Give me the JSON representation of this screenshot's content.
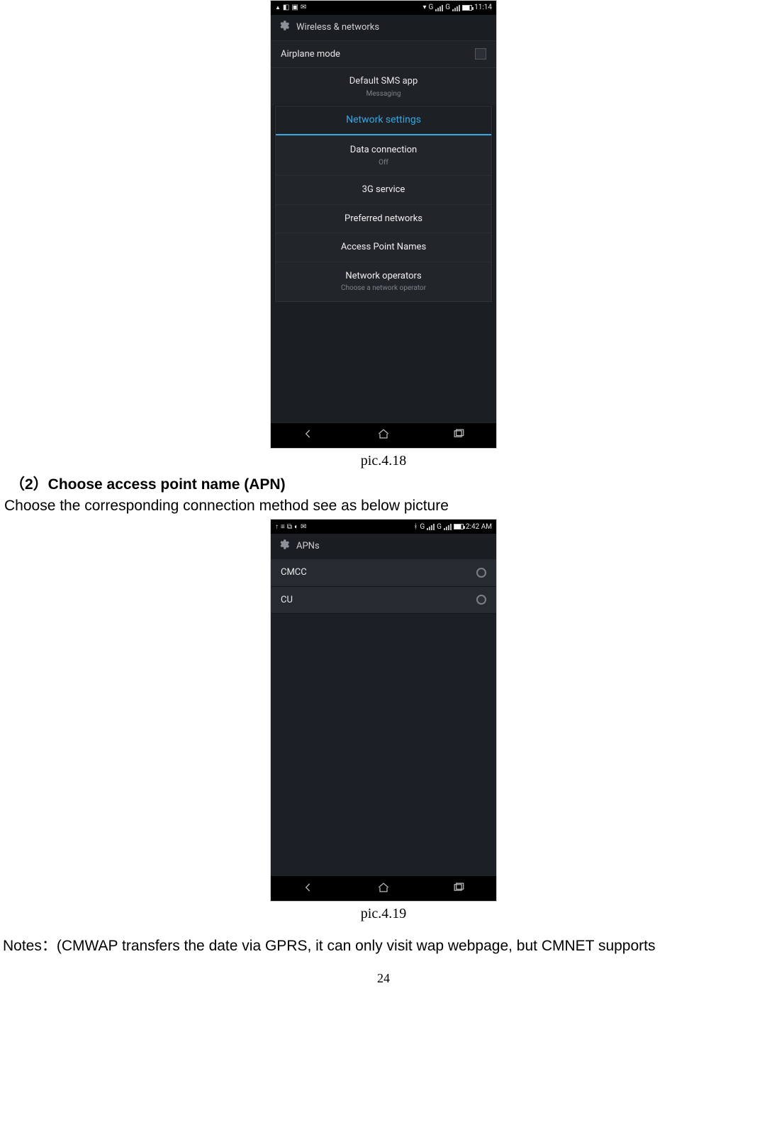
{
  "captions": {
    "pic418": "pic.4.18",
    "pic419": "pic.4.19"
  },
  "heading2": "（2）Choose access point name (APN)",
  "body_line": "Choose the corresponding connection method see as below picture",
  "notes_line": "Notes：(CMWAP transfers the date via GPRS, it can only visit wap webpage, but CMNET supports",
  "page_number": "24",
  "phone1": {
    "status": {
      "time": "11:14",
      "right_extra": "G"
    },
    "title": "Wireless & networks",
    "rows": {
      "airplane": "Airplane mode",
      "default_sms": "Default SMS app",
      "default_sms_sub": "Messaging"
    },
    "dialog_title": "Network settings",
    "dialog_rows": [
      {
        "label": "Data connection",
        "sub": "Off"
      },
      {
        "label": "3G service",
        "sub": ""
      },
      {
        "label": "Preferred networks",
        "sub": ""
      },
      {
        "label": "Access Point Names",
        "sub": ""
      },
      {
        "label": "Network operators",
        "sub": "Choose a network operator"
      }
    ]
  },
  "phone2": {
    "status": {
      "time": "2:42 AM",
      "right_extra": "G"
    },
    "title": "APNs",
    "items": [
      {
        "name": "CMCC"
      },
      {
        "name": "CU"
      }
    ]
  }
}
